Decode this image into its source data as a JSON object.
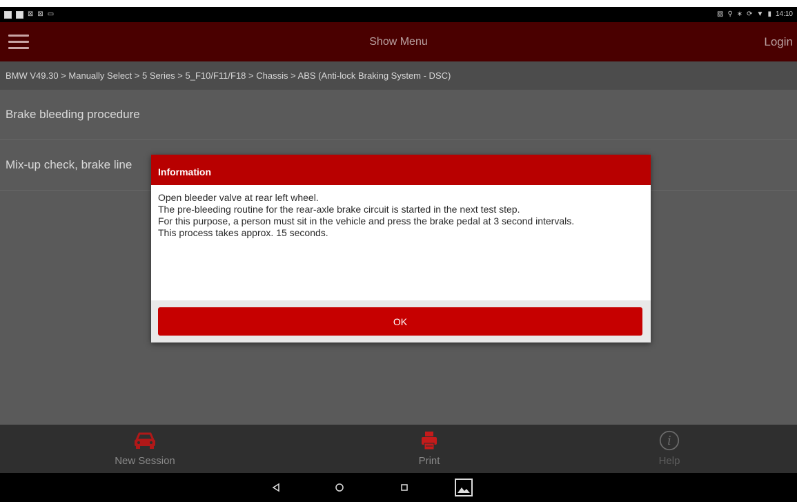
{
  "statusbar": {
    "time": "14:10"
  },
  "appbar": {
    "title": "Show Menu",
    "login_label": "Login"
  },
  "breadcrumb": "BMW V49.30 > Manually Select > 5 Series > 5_F10/F11/F18 > Chassis > ABS (Anti-lock Braking System - DSC)",
  "list": {
    "items": [
      {
        "label": "Brake bleeding procedure"
      },
      {
        "label": "Mix-up check, brake line"
      }
    ]
  },
  "dialog": {
    "title": "Information",
    "lines": [
      "Open bleeder valve at rear left wheel.",
      "The pre-bleeding routine for the rear-axle brake circuit is started in the next test step.",
      "For this purpose, a person must sit in the vehicle and press the brake pedal at 3 second intervals.",
      "This process takes approx. 15 seconds."
    ],
    "ok_label": "OK"
  },
  "bottombar": {
    "new_session_label": "New Session",
    "print_label": "Print",
    "help_label": "Help"
  },
  "colors": {
    "appbar": "#4a0000",
    "accent_red": "#c60000",
    "dialog_header": "#b80000"
  }
}
